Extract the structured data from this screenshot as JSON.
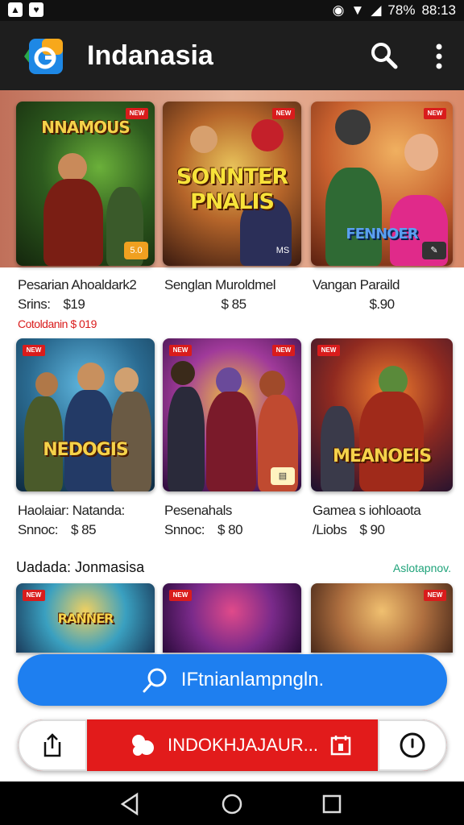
{
  "status_bar": {
    "battery": "78%",
    "time": "88:13"
  },
  "app_bar": {
    "title": "Indanasia"
  },
  "games_row1": [
    {
      "art_title": "NNAMOUS",
      "name": "Pesarian Ahoaldark2",
      "label": "Srins:",
      "price": "$19",
      "sale": "Cotoldanin $ 019",
      "corner": "5.0"
    },
    {
      "art_title": "SONNTER PNALIS",
      "name": "Senglan Muroldmel",
      "label": "",
      "price": "$ 85",
      "corner": "MS"
    },
    {
      "art_title": "FENNOER",
      "name": "Vangan Paraild",
      "label": "",
      "price": "$.90",
      "corner": "✎"
    }
  ],
  "games_row2": [
    {
      "art_title": "NEDOGIS",
      "name": "Haolaiar: Natanda:",
      "label": "Snnoc:",
      "price": "$ 85",
      "corner": ""
    },
    {
      "art_title": "",
      "name": "Pesenahals",
      "label": "Snnoc:",
      "price": "$ 80",
      "corner": "▤"
    },
    {
      "art_title": "MEANOEIS",
      "name": "Gamea s iohloaota",
      "label": "/Liobs",
      "price": "$ 90",
      "corner": ""
    }
  ],
  "section": {
    "title": "Uadada: Jonmasisa",
    "link": "Aslotapnov."
  },
  "games_row3": [
    {
      "art_title": "RANNER"
    },
    {
      "art_title": ""
    },
    {
      "art_title": ""
    }
  ],
  "badge_text": "NEW",
  "actions": {
    "primary_label": "IFtnianlampngln.",
    "secondary_label": "INDOKHJAJAUR..."
  },
  "colors": {
    "accent_blue": "#1e7ff0",
    "accent_red": "#e21b1b",
    "link_green": "#1fa37a"
  }
}
